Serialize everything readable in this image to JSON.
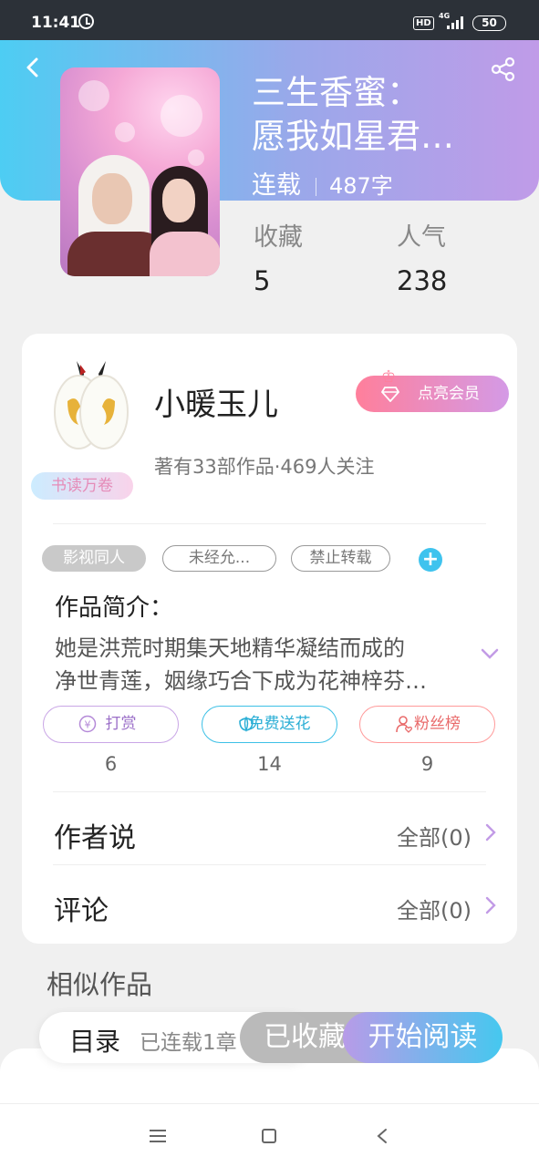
{
  "status_bar": {
    "time": "11:41",
    "hd": "HD",
    "network": "4G",
    "battery": "50"
  },
  "book": {
    "title_line1": "三生香蜜：",
    "title_line2": "愿我如星君…",
    "status": "连载",
    "words": "487字",
    "stats": [
      {
        "label": "收藏",
        "value": "5"
      },
      {
        "label": "人气",
        "value": "238"
      }
    ]
  },
  "author": {
    "name": "小暖玉儿",
    "stats": "著有33部作品·469人关注",
    "badge": "书读万卷",
    "vip_label": "点亮会员"
  },
  "tags": [
    "影视同人",
    "未经允...",
    "禁止转载"
  ],
  "tag_add": "+",
  "intro": {
    "title": "作品简介：",
    "line1": "她是洪荒时期集天地精华凝结而成的",
    "line2": "净世青莲，姻缘巧合下成为花神梓芬…"
  },
  "actions": [
    {
      "label": "打赏",
      "count": "6",
      "icon": "coin-icon"
    },
    {
      "label": "免费送花",
      "count": "14",
      "icon": "flower-icon"
    },
    {
      "label": "粉丝榜",
      "count": "9",
      "icon": "fan-user-icon"
    }
  ],
  "author_says": {
    "label": "作者说",
    "value": "全部(0)"
  },
  "comments": {
    "label": "评论",
    "value": "全部(0)"
  },
  "similar_title": "相似作品",
  "bottom": {
    "toc_label": "目录",
    "toc_count": "已连载1章",
    "fav_label": "已收藏",
    "read_label": "开始阅读"
  },
  "colors": {
    "header_start": "#4dcdf3",
    "header_end": "#c09be8",
    "accent_blue": "#3fc3ee",
    "vip_pink": "#ff7f9b"
  }
}
